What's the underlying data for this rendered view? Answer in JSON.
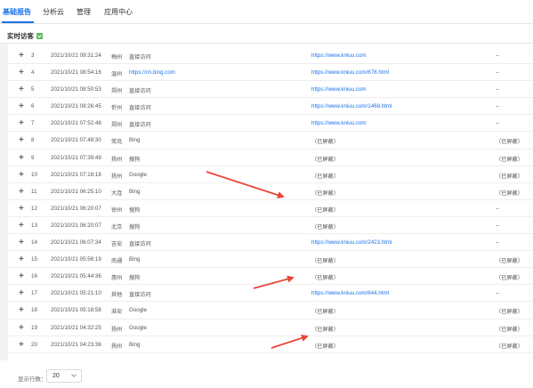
{
  "nav": {
    "tabs": [
      {
        "label": "基础报告",
        "active": true
      },
      {
        "label": "分析云",
        "active": false
      },
      {
        "label": "管理",
        "active": false
      },
      {
        "label": "应用中心",
        "active": false
      }
    ]
  },
  "section": {
    "title": "实时访客"
  },
  "rows": [
    {
      "n": "3",
      "time": "2021/10/21 09:31:24",
      "city": "梅州",
      "source": "直接访问",
      "landing": "https://www.kniuu.com",
      "keyword": "--"
    },
    {
      "n": "4",
      "time": "2021/10/21 08:54:16",
      "city": "温州",
      "source": "https://cn.bing.com",
      "landing": "https://www.kniuu.com/678.html",
      "keyword": "--"
    },
    {
      "n": "5",
      "time": "2021/10/21 08:50:53",
      "city": "郑州",
      "source": "直接访问",
      "landing": "https://www.kniuu.com",
      "keyword": "--"
    },
    {
      "n": "6",
      "time": "2021/10/21 08:26:45",
      "city": "忻州",
      "source": "直接访问",
      "landing": "https://www.kniuu.com/1468.html",
      "keyword": "--"
    },
    {
      "n": "7",
      "time": "2021/10/21 07:52:48",
      "city": "郑州",
      "source": "直接访问",
      "landing": "https://www.kniuu.com",
      "keyword": "--"
    },
    {
      "n": "8",
      "time": "2021/10/21 07:48:30",
      "city": "莞岛",
      "source": "Bing",
      "landing": "（已屏蔽）",
      "keyword": "（已屏蔽）"
    },
    {
      "n": "9",
      "time": "2021/10/21 07:39:49",
      "city": "扬州",
      "source": "搜狗",
      "landing": "（已屏蔽）",
      "keyword": "（已屏蔽）"
    },
    {
      "n": "10",
      "time": "2021/10/21 07:18:18",
      "city": "扬州",
      "source": "Google",
      "landing": "（已屏蔽）",
      "keyword": "（已屏蔽）"
    },
    {
      "n": "11",
      "time": "2021/10/21 06:25:10",
      "city": "大连",
      "source": "Bing",
      "landing": "（已屏蔽）",
      "keyword": "（已屏蔽）"
    },
    {
      "n": "12",
      "time": "2021/10/21 06:20:07",
      "city": "徐州",
      "source": "搜狗",
      "landing": "（已屏蔽）",
      "keyword": "--"
    },
    {
      "n": "13",
      "time": "2021/10/21 06:20:07",
      "city": "北京",
      "source": "搜狗",
      "landing": "（已屏蔽）",
      "keyword": "--"
    },
    {
      "n": "14",
      "time": "2021/10/21 06:07:34",
      "city": "吉安",
      "source": "直接访问",
      "landing": "https://www.kniuu.com/2423.html",
      "keyword": "--"
    },
    {
      "n": "15",
      "time": "2021/10/21 05:56:19",
      "city": "南通",
      "source": "Bing",
      "landing": "（已屏蔽）",
      "keyword": "（已屏蔽）"
    },
    {
      "n": "16",
      "time": "2021/10/21 05:44:36",
      "city": "惠州",
      "source": "搜狗",
      "landing": "（已屏蔽）",
      "keyword": "（已屏蔽）"
    },
    {
      "n": "17",
      "time": "2021/10/21 05:21:10",
      "city": "其他",
      "source": "直接访问",
      "landing": "https://www.kniuu.com/844.html",
      "keyword": "--"
    },
    {
      "n": "18",
      "time": "2021/10/21 05:18:58",
      "city": "淮安",
      "source": "Google",
      "landing": "（已屏蔽）",
      "keyword": "（已屏蔽）"
    },
    {
      "n": "19",
      "time": "2021/10/21 04:32:25",
      "city": "扬州",
      "source": "Google",
      "landing": "（已屏蔽）",
      "keyword": "（已屏蔽）"
    },
    {
      "n": "20",
      "time": "2021/10/21 04:23:36",
      "city": "扬州",
      "source": "Bing",
      "landing": "（已屏蔽）",
      "keyword": "（已屏蔽）"
    }
  ],
  "pagination": {
    "label": "显示行数：",
    "value": "20"
  },
  "colors": {
    "accent": "#1a73e8",
    "arrow": "#e8463a",
    "badge": "#5cb85c"
  },
  "icons": {
    "expand": "plus-icon",
    "badge": "check-badge-icon",
    "dropdown": "chevron-down-icon"
  }
}
